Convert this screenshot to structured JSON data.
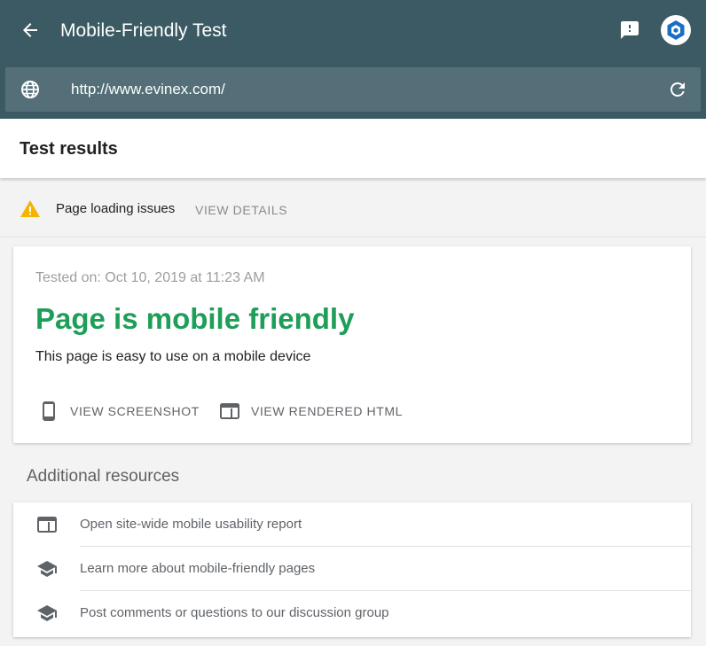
{
  "header": {
    "title": "Mobile-Friendly Test",
    "url": "http://www.evinex.com/"
  },
  "results": {
    "title": "Test results"
  },
  "issues": {
    "text": "Page loading issues",
    "details_label": "VIEW DETAILS"
  },
  "card": {
    "tested_on": "Tested on: Oct 10, 2019 at 11:23 AM",
    "headline": "Page is mobile friendly",
    "subtitle": "This page is easy to use on a mobile device",
    "actions": [
      {
        "label": "VIEW SCREENSHOT",
        "icon": "smartphone-icon"
      },
      {
        "label": "VIEW RENDERED HTML",
        "icon": "web-window-icon"
      }
    ]
  },
  "additional": {
    "title": "Additional resources",
    "items": [
      {
        "label": "Open site-wide mobile usability report",
        "icon": "web-window-icon"
      },
      {
        "label": "Learn more about mobile-friendly pages",
        "icon": "school-cap-icon"
      },
      {
        "label": "Post comments or questions to our discussion group",
        "icon": "school-cap-icon"
      }
    ]
  },
  "colors": {
    "header_bg": "#3c5a63",
    "url_bar_bg": "#546f77",
    "success_green": "#1e9e58",
    "warning_yellow": "#f4b400"
  }
}
